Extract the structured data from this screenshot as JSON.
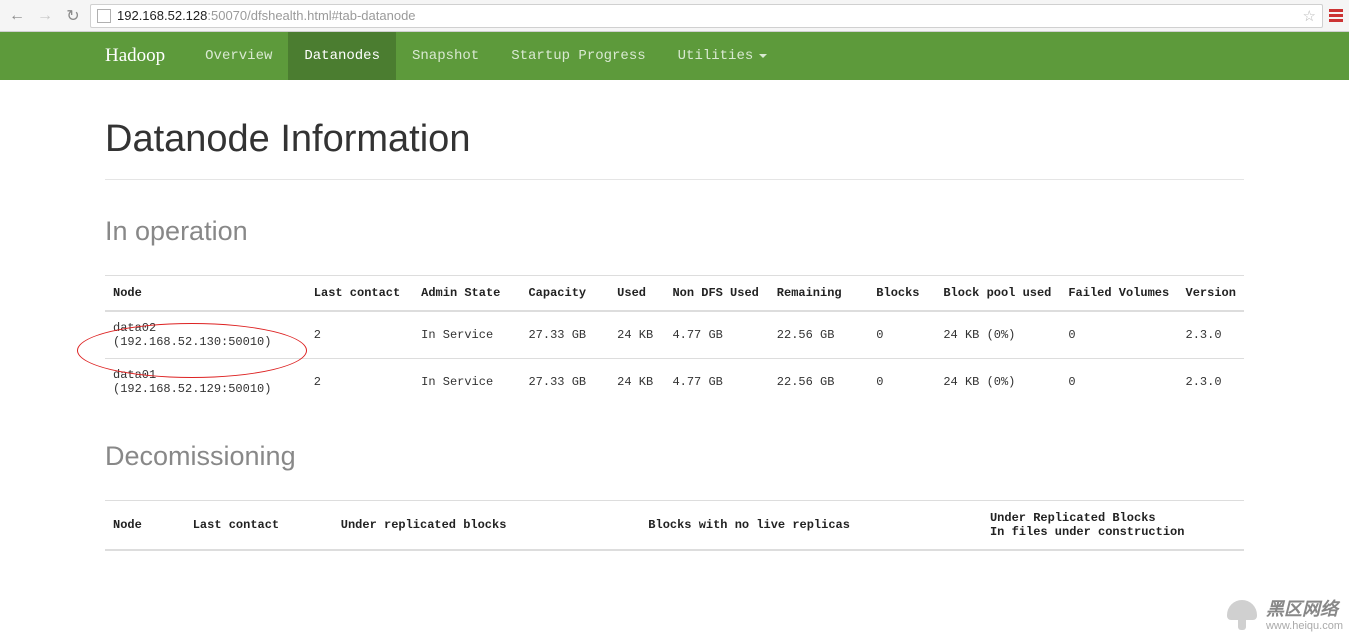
{
  "browser": {
    "url_host": "192.168.52.128",
    "url_path": ":50070/dfshealth.html#tab-datanode"
  },
  "navbar": {
    "brand": "Hadoop",
    "items": [
      {
        "label": "Overview",
        "active": false
      },
      {
        "label": "Datanodes",
        "active": true
      },
      {
        "label": "Snapshot",
        "active": false
      },
      {
        "label": "Startup Progress",
        "active": false
      },
      {
        "label": "Utilities",
        "active": false,
        "dropdown": true
      }
    ]
  },
  "page": {
    "title": "Datanode Information",
    "section_in_operation": "In operation",
    "section_decommissioning": "Decomissioning"
  },
  "in_operation_table": {
    "headers": [
      "Node",
      "Last contact",
      "Admin State",
      "Capacity",
      "Used",
      "Non DFS Used",
      "Remaining",
      "Blocks",
      "Block pool used",
      "Failed Volumes",
      "Version"
    ],
    "rows": [
      {
        "node": "data02 (192.168.52.130:50010)",
        "last_contact": "2",
        "admin_state": "In Service",
        "capacity": "27.33 GB",
        "used": "24 KB",
        "non_dfs": "4.77 GB",
        "remaining": "22.56 GB",
        "blocks": "0",
        "pool_used": "24 KB (0%)",
        "failed_vol": "0",
        "version": "2.3.0"
      },
      {
        "node": "data01 (192.168.52.129:50010)",
        "last_contact": "2",
        "admin_state": "In Service",
        "capacity": "27.33 GB",
        "used": "24 KB",
        "non_dfs": "4.77 GB",
        "remaining": "22.56 GB",
        "blocks": "0",
        "pool_used": "24 KB (0%)",
        "failed_vol": "0",
        "version": "2.3.0"
      }
    ]
  },
  "decommissioning_table": {
    "headers": [
      "Node",
      "Last contact",
      "Under replicated blocks",
      "Blocks with no live replicas",
      "Under Replicated Blocks\nIn files under construction"
    ]
  },
  "watermark": {
    "big": "黑区网络",
    "small": "www.heiqu.com"
  }
}
